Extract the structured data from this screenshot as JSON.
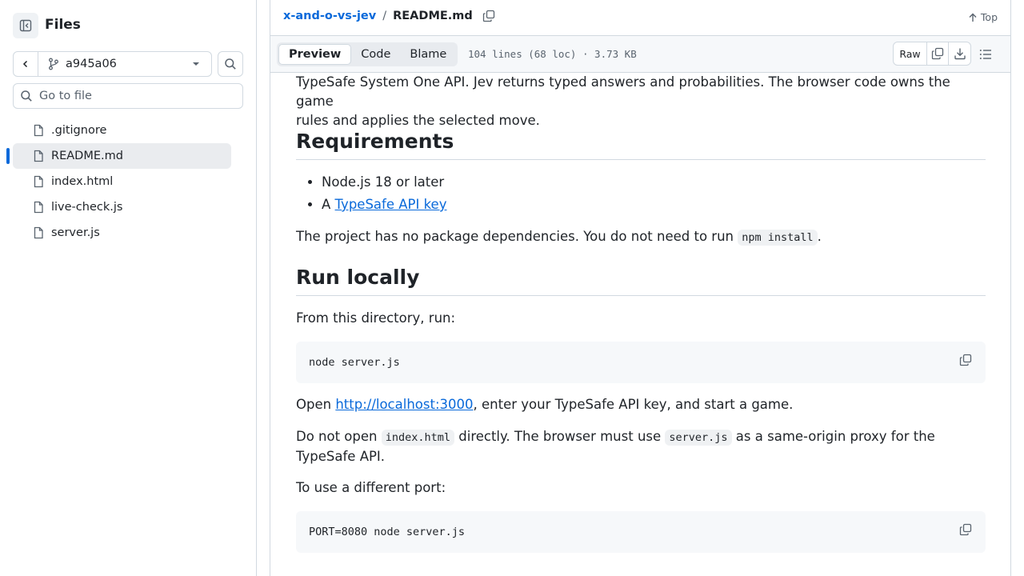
{
  "sidebar": {
    "title": "Files",
    "branch": "a945a06",
    "goto_placeholder": "Go to file",
    "files": [
      {
        "name": ".gitignore"
      },
      {
        "name": "README.md"
      },
      {
        "name": "index.html"
      },
      {
        "name": "live-check.js"
      },
      {
        "name": "server.js"
      }
    ],
    "active_file": "README.md"
  },
  "header": {
    "repo": "x-and-o-vs-jev",
    "separator": "/",
    "file": "README.md",
    "top_label": "Top"
  },
  "toolbar": {
    "tabs": [
      "Preview",
      "Code",
      "Blame"
    ],
    "active_tab": "Preview",
    "file_info": "104 lines (68 loc) · 3.73 KB",
    "raw_label": "Raw"
  },
  "content": {
    "intro_line1": "TypeSafe System One API. Jev returns typed answers and probabilities. The browser code owns the game",
    "intro_line2": "rules and applies the selected move.",
    "requirements_heading": "Requirements",
    "req_item1": "Node.js 18 or later",
    "req_item2_prefix": "A ",
    "req_item2_link": "TypeSafe API key",
    "nodeps_text": "The project has no package dependencies. You do not need to run ",
    "nodeps_code": "npm install",
    "nodeps_end": ".",
    "run_heading": "Run locally",
    "from_dir": "From this directory, run:",
    "code1": "node server.js",
    "open_prefix": "Open ",
    "open_link": "http://localhost:3000",
    "open_suffix": ", enter your TypeSafe API key, and start a game.",
    "donot_1": "Do not open ",
    "donot_code1": "index.html",
    "donot_2": " directly. The browser must use ",
    "donot_code2": "server.js",
    "donot_3": " as a same-origin proxy for the TypeSafe API.",
    "port_text": "To use a different port:",
    "code2": "PORT=8080 node server.js"
  },
  "colors": {
    "link": "#0969da",
    "border": "#d1d9e0",
    "muted": "#59636e",
    "active_indicator": "#0969da"
  }
}
